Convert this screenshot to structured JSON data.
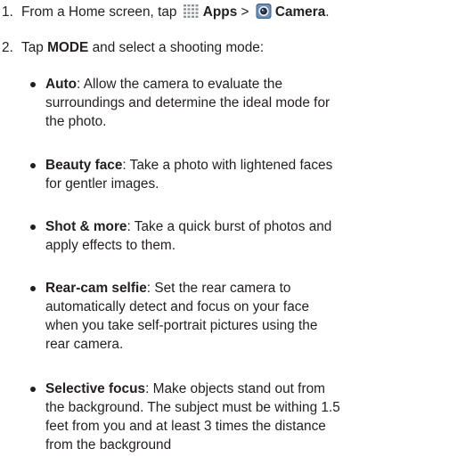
{
  "steps": [
    {
      "number": "1.",
      "prefix": "From a Home screen, tap",
      "apps_icon": "apps-grid-icon",
      "apps_label": "Apps",
      "separator": ">",
      "camera_icon": "camera-app-icon",
      "camera_label": "Camera",
      "suffix": "."
    },
    {
      "number": "2.",
      "prefix": "Tap",
      "bold": "MODE",
      "suffix": "and select a shooting mode:"
    }
  ],
  "modes": [
    {
      "name": "Auto",
      "lines": [
        ": Allow the camera to evaluate the",
        "surroundings and determine the ideal mode for",
        "the photo."
      ]
    },
    {
      "name": "Beauty face",
      "lines": [
        ": Take a photo with lightened faces",
        "for gentler images."
      ]
    },
    {
      "name": "Shot & more",
      "lines": [
        ": Take a quick burst of photos and",
        "apply effects to them."
      ]
    },
    {
      "name": "Rear-cam selfie",
      "lines": [
        ": Set the rear camera to",
        "automatically detect and focus on your face",
        "when you take self-portrait pictures using the",
        "rear camera."
      ]
    },
    {
      "name": "Selective focus",
      "lines": [
        ": Make objects stand out from",
        "the background. The subject must be withing 1.5",
        "feet from you and at least 3 times the distance",
        "from the background"
      ]
    }
  ],
  "colors": {
    "text": "#231f20",
    "apps_icon": "#8a9199",
    "camera_icon_bg": "#3a5f8c"
  }
}
